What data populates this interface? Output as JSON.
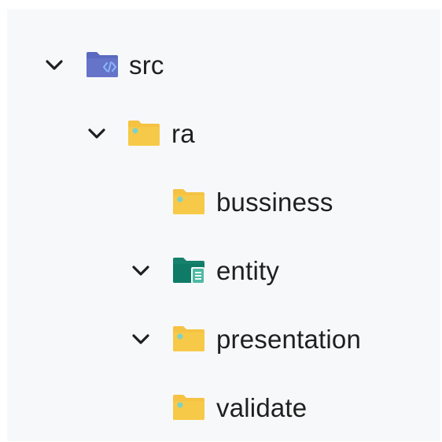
{
  "tree": {
    "nodes": [
      {
        "label": "src",
        "icon": "source-folder-icon",
        "expanded": true,
        "has_chevron": true
      },
      {
        "label": "ra",
        "icon": "package-folder-icon",
        "expanded": true,
        "has_chevron": true
      },
      {
        "label": "bussiness",
        "icon": "package-folder-icon",
        "expanded": false,
        "has_chevron": false
      },
      {
        "label": "entity",
        "icon": "entity-folder-icon",
        "expanded": true,
        "has_chevron": true
      },
      {
        "label": "presentation",
        "icon": "package-folder-icon",
        "expanded": true,
        "has_chevron": true
      },
      {
        "label": "validate",
        "icon": "package-folder-icon",
        "expanded": false,
        "has_chevron": false
      }
    ]
  },
  "colors": {
    "panel_background": "#f7f8fa",
    "source_folder": "#5b6abf",
    "source_folder_code": "#8ab4f8",
    "package_folder": "#f5c242",
    "package_dot": "#7fd1c8",
    "entity_folder": "#15806b",
    "text": "#1f1f1f"
  }
}
